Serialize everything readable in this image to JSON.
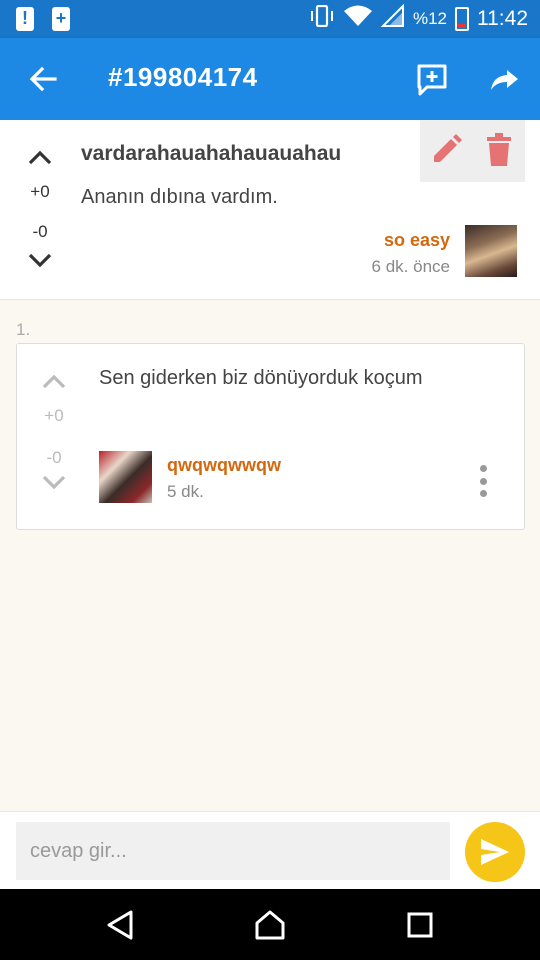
{
  "status_bar": {
    "battery_percent": "%12",
    "time": "11:42",
    "icons": [
      "alert-icon",
      "battery-charge-icon",
      "vibrate-icon",
      "wifi-icon",
      "signal-icon",
      "battery-icon"
    ]
  },
  "app_bar": {
    "title": "#199804174",
    "back_icon": "arrow-back-icon",
    "add_comment_icon": "add-comment-icon",
    "share_icon": "share-icon"
  },
  "post": {
    "title": "vardarahauahahauauahau",
    "body": "Ananın dıbına vardım.",
    "score_plus": "+0",
    "score_minus": "-0",
    "user_name": "so easy",
    "time": "6 dk. önce"
  },
  "replies": [
    {
      "index": "1.",
      "body": "Sen giderken biz dönüyorduk koçum",
      "score_plus": "+0",
      "score_minus": "-0",
      "user_name": "qwqwqwwqw",
      "time": "5 dk."
    }
  ],
  "input": {
    "placeholder": "cevap gir..."
  },
  "colors": {
    "primary": "#1e88e5",
    "status_bar": "#1976c8",
    "accent_username": "#d2690e",
    "send_button": "#f5c518",
    "delete_red": "#e57373"
  }
}
